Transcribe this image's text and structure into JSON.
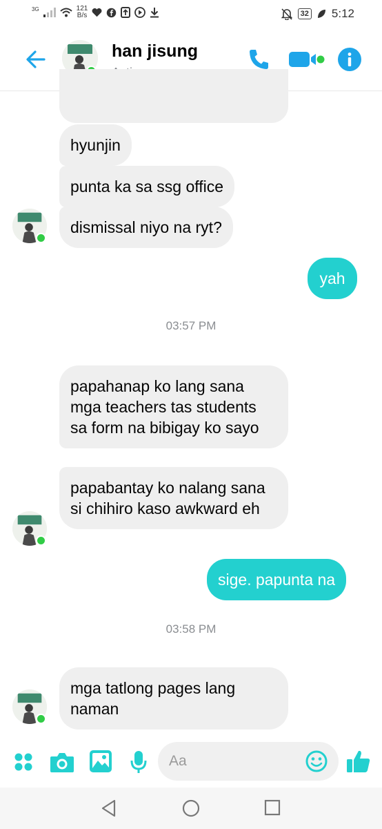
{
  "status_bar": {
    "network": "3G",
    "speed_value": "121",
    "speed_unit": "B/s",
    "battery": "32",
    "time": "5:12"
  },
  "header": {
    "name": "han jisung",
    "status": "Active now"
  },
  "messages": [
    {
      "text": "hyunjin",
      "side": "in"
    },
    {
      "text": "punta ka sa ssg office",
      "side": "in"
    },
    {
      "text": "dismissal niyo na ryt?",
      "side": "in"
    },
    {
      "text": "yah",
      "side": "out"
    },
    {
      "text": "papahanap ko lang sana mga teachers tas students sa form na bibigay ko sayo",
      "side": "in"
    },
    {
      "text": "papabantay ko nalang sana si chihiro kaso awkward eh",
      "side": "in"
    },
    {
      "text": "sige. papunta na",
      "side": "out"
    },
    {
      "text": "mga tatlong pages lang naman",
      "side": "in"
    }
  ],
  "timestamps": [
    "03:57 PM",
    "03:58 PM"
  ],
  "composer": {
    "placeholder": "Aa"
  },
  "colors": {
    "accent": "#23d0cf",
    "messenger_blue": "#1ea5e9",
    "online": "#31cc46",
    "incoming_bubble": "#efefef"
  },
  "icons": {
    "header": [
      "back-arrow-icon",
      "phone-icon",
      "video-icon",
      "info-icon"
    ],
    "composer": [
      "menu-dots-icon",
      "camera-icon",
      "image-icon",
      "microphone-icon",
      "emoji-icon",
      "thumbs-up-icon"
    ],
    "navigation": [
      "nav-back-icon",
      "nav-home-icon",
      "nav-recents-icon"
    ]
  }
}
